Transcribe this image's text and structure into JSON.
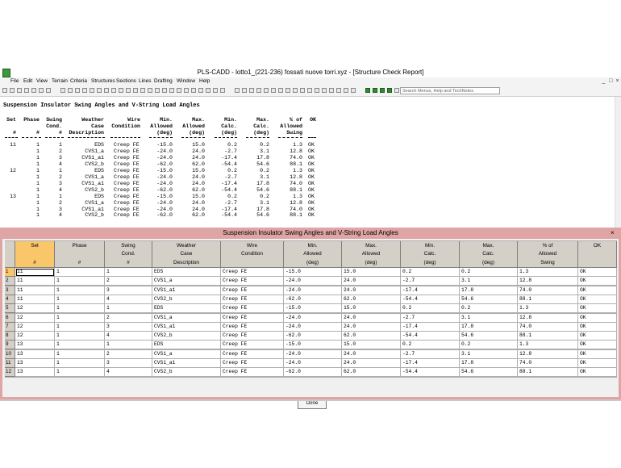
{
  "window": {
    "title": "PLS-CADD - lotto1_(221-236) fossati nuove torri.xyz - [Structure Check Report]"
  },
  "menu": [
    "File",
    "Edit",
    "View",
    "Terrain",
    "Criteria",
    "Structures",
    "Sections",
    "Lines",
    "Drafting",
    "Window",
    "Help"
  ],
  "window_controls": {
    "minimize": "_",
    "restore": "□",
    "close": "×"
  },
  "search": {
    "placeholder": "Search Menus, Help and TechNotes"
  },
  "report": {
    "title": "Suspension Insulator Swing Angles and V-String Load Angles",
    "header_lines": [
      " Set  Phase  Swing  Weather          Wire      Min.    Max.     Min.    Max.    % of  OK",
      "                    Cond.     Case Condition  Allowed  Allowed  Calc.   Calc.  Allowed",
      "   #      #      #  Description              (deg)    (deg)    (deg)   (deg)   Swing"
    ],
    "rows": [
      {
        "set": "11",
        "phase": "1",
        "cond": "1",
        "desc": "EDS",
        "wire": "Creep FE",
        "min_allowed": "-15.0",
        "max_allowed": "15.0",
        "min_calc": "0.2",
        "max_calc": "0.2",
        "pct": "1.3",
        "ok": "OK"
      },
      {
        "set": "",
        "phase": "1",
        "cond": "2",
        "desc": "CVS1_a",
        "wire": "Creep FE",
        "min_allowed": "-24.0",
        "max_allowed": "24.0",
        "min_calc": "-2.7",
        "max_calc": "3.1",
        "pct": "12.8",
        "ok": "OK"
      },
      {
        "set": "",
        "phase": "1",
        "cond": "3",
        "desc": "CVS1_a1",
        "wire": "Creep FE",
        "min_allowed": "-24.0",
        "max_allowed": "24.0",
        "min_calc": "-17.4",
        "max_calc": "17.8",
        "pct": "74.0",
        "ok": "OK"
      },
      {
        "set": "",
        "phase": "1",
        "cond": "4",
        "desc": "CVS2_b",
        "wire": "Creep FE",
        "min_allowed": "-62.0",
        "max_allowed": "62.0",
        "min_calc": "-54.4",
        "max_calc": "54.6",
        "pct": "88.1",
        "ok": "OK"
      },
      {
        "set": "12",
        "phase": "1",
        "cond": "1",
        "desc": "EDS",
        "wire": "Creep FE",
        "min_allowed": "-15.0",
        "max_allowed": "15.0",
        "min_calc": "0.2",
        "max_calc": "0.2",
        "pct": "1.3",
        "ok": "OK"
      },
      {
        "set": "",
        "phase": "1",
        "cond": "2",
        "desc": "CVS1_a",
        "wire": "Creep FE",
        "min_allowed": "-24.0",
        "max_allowed": "24.0",
        "min_calc": "-2.7",
        "max_calc": "3.1",
        "pct": "12.8",
        "ok": "OK"
      },
      {
        "set": "",
        "phase": "1",
        "cond": "3",
        "desc": "CVS1_a1",
        "wire": "Creep FE",
        "min_allowed": "-24.0",
        "max_allowed": "24.0",
        "min_calc": "-17.4",
        "max_calc": "17.8",
        "pct": "74.0",
        "ok": "OK"
      },
      {
        "set": "",
        "phase": "1",
        "cond": "4",
        "desc": "CVS2_b",
        "wire": "Creep FE",
        "min_allowed": "-62.0",
        "max_allowed": "62.0",
        "min_calc": "-54.4",
        "max_calc": "54.6",
        "pct": "88.1",
        "ok": "OK"
      },
      {
        "set": "13",
        "phase": "1",
        "cond": "1",
        "desc": "EDS",
        "wire": "Creep FE",
        "min_allowed": "-15.0",
        "max_allowed": "15.0",
        "min_calc": "0.2",
        "max_calc": "0.2",
        "pct": "1.3",
        "ok": "OK"
      },
      {
        "set": "",
        "phase": "1",
        "cond": "2",
        "desc": "CVS1_a",
        "wire": "Creep FE",
        "min_allowed": "-24.0",
        "max_allowed": "24.0",
        "min_calc": "-2.7",
        "max_calc": "3.1",
        "pct": "12.8",
        "ok": "OK"
      },
      {
        "set": "",
        "phase": "1",
        "cond": "3",
        "desc": "CVS1_a1",
        "wire": "Creep FE",
        "min_allowed": "-24.0",
        "max_allowed": "24.0",
        "min_calc": "-17.4",
        "max_calc": "17.8",
        "pct": "74.0",
        "ok": "OK"
      },
      {
        "set": "",
        "phase": "1",
        "cond": "4",
        "desc": "CVS2_b",
        "wire": "Creep FE",
        "min_allowed": "-62.0",
        "max_allowed": "62.0",
        "min_calc": "-54.4",
        "max_calc": "54.6",
        "pct": "88.1",
        "ok": "OK"
      }
    ]
  },
  "dialog": {
    "title": "Suspension Insulator Swing Angles and V-String Load Angles",
    "close": "×",
    "columns": [
      "Set\n\n#",
      "Phase\n\n#",
      "Swing\nCond.\n#",
      "Weather\nCase\nDescription",
      "Wire\nCondition",
      "Min.\nAllowed\n(deg)",
      "Max.\nAllowed\n(deg)",
      "Min.\nCalc.\n(deg)",
      "Max.\nCalc.\n(deg)",
      "% of\nAllowed\nSwing",
      "OK"
    ],
    "rows": [
      [
        "11",
        "1",
        "1",
        "EDS",
        "Creep FE",
        "-15.0",
        "15.0",
        "0.2",
        "0.2",
        "1.3",
        "OK"
      ],
      [
        "11",
        "1",
        "2",
        "CVS1_a",
        "Creep FE",
        "-24.0",
        "24.0",
        "-2.7",
        "3.1",
        "12.8",
        "OK"
      ],
      [
        "11",
        "1",
        "3",
        "CVS1_a1",
        "Creep FE",
        "-24.0",
        "24.0",
        "-17.4",
        "17.8",
        "74.0",
        "OK"
      ],
      [
        "11",
        "1",
        "4",
        "CVS2_b",
        "Creep FE",
        "-62.0",
        "62.0",
        "-54.4",
        "54.6",
        "88.1",
        "OK"
      ],
      [
        "12",
        "1",
        "1",
        "EDS",
        "Creep FE",
        "-15.0",
        "15.0",
        "0.2",
        "0.2",
        "1.3",
        "OK"
      ],
      [
        "12",
        "1",
        "2",
        "CVS1_a",
        "Creep FE",
        "-24.0",
        "24.0",
        "-2.7",
        "3.1",
        "12.8",
        "OK"
      ],
      [
        "12",
        "1",
        "3",
        "CVS1_a1",
        "Creep FE",
        "-24.0",
        "24.0",
        "-17.4",
        "17.8",
        "74.0",
        "OK"
      ],
      [
        "12",
        "1",
        "4",
        "CVS2_b",
        "Creep FE",
        "-62.0",
        "62.0",
        "-54.4",
        "54.6",
        "88.1",
        "OK"
      ],
      [
        "13",
        "1",
        "1",
        "EDS",
        "Creep FE",
        "-15.0",
        "15.0",
        "0.2",
        "0.2",
        "1.3",
        "OK"
      ],
      [
        "13",
        "1",
        "2",
        "CVS1_a",
        "Creep FE",
        "-24.0",
        "24.0",
        "-2.7",
        "3.1",
        "12.8",
        "OK"
      ],
      [
        "13",
        "1",
        "3",
        "CVS1_a1",
        "Creep FE",
        "-24.0",
        "24.0",
        "-17.4",
        "17.8",
        "74.0",
        "OK"
      ],
      [
        "13",
        "1",
        "4",
        "CVS2_b",
        "Creep FE",
        "-62.0",
        "62.0",
        "-54.4",
        "54.6",
        "88.1",
        "OK"
      ]
    ],
    "done_label": "Done"
  },
  "colors": {
    "dialog_frame": "#dfa4a4",
    "active_header": "#f9c76a",
    "grid_header": "#d4d0c8"
  },
  "icons": [
    "new-file-icon",
    "open-icon",
    "save-icon",
    "print-icon",
    "zoom-icon",
    "pan-icon",
    "green-tool-icon"
  ]
}
